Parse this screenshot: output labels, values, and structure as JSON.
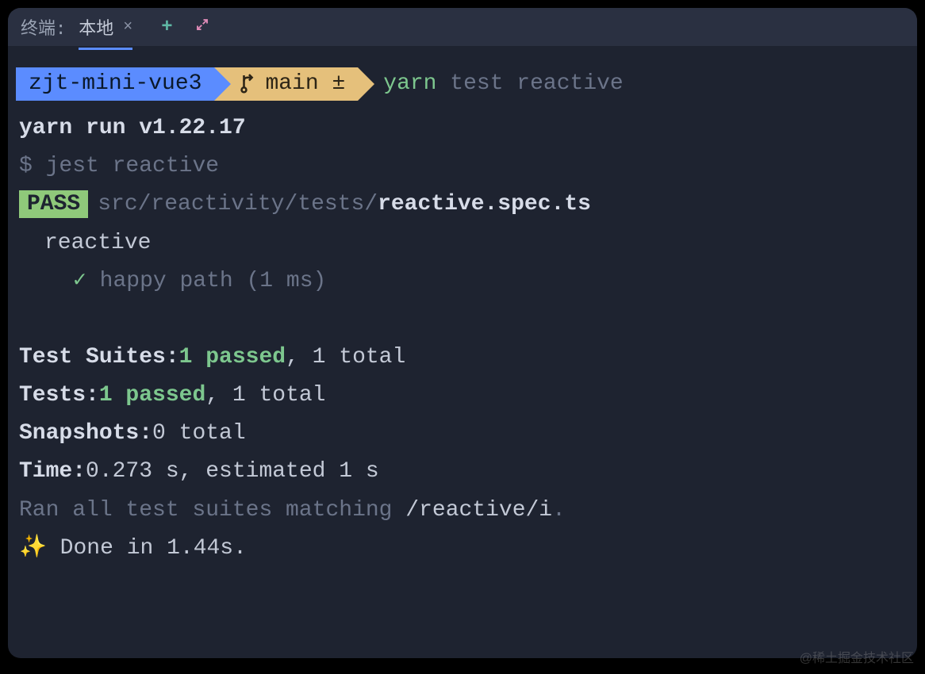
{
  "titlebar": {
    "label": "终端:",
    "tab_name": "本地",
    "close": "×",
    "plus": "+",
    "expand": "⤢"
  },
  "prompt": {
    "project": "zjt-mini-vue3",
    "branch": "main ±",
    "cmd_bin": "yarn",
    "cmd_args": "test reactive"
  },
  "output": {
    "yarn_run": "yarn run v1.22.17",
    "jest_prefix": "$ ",
    "jest_cmd": "jest reactive",
    "pass_label": "PASS",
    "path_dim": "src/reactivity/tests/",
    "path_file": "reactive.spec.ts",
    "suite_name": "reactive",
    "check": "✓",
    "test_name": "happy path (1 ms)"
  },
  "summary": {
    "suites_label": "Test Suites: ",
    "suites_passed": "1 passed",
    "suites_total": ", 1 total",
    "tests_label": "Tests:       ",
    "tests_passed": "1 passed",
    "tests_total": ", 1 total",
    "snapshots_label": "Snapshots:   ",
    "snapshots_value": "0 total",
    "time_label": "Time:        ",
    "time_value": "0.273 s, estimated 1 s",
    "ran_prefix": "Ran all test suites matching ",
    "ran_pattern": "/reactive/i",
    "ran_suffix": ".",
    "sparkle": "✨",
    "done": "  Done in 1.44s."
  },
  "watermark": "@稀土掘金技术社区"
}
